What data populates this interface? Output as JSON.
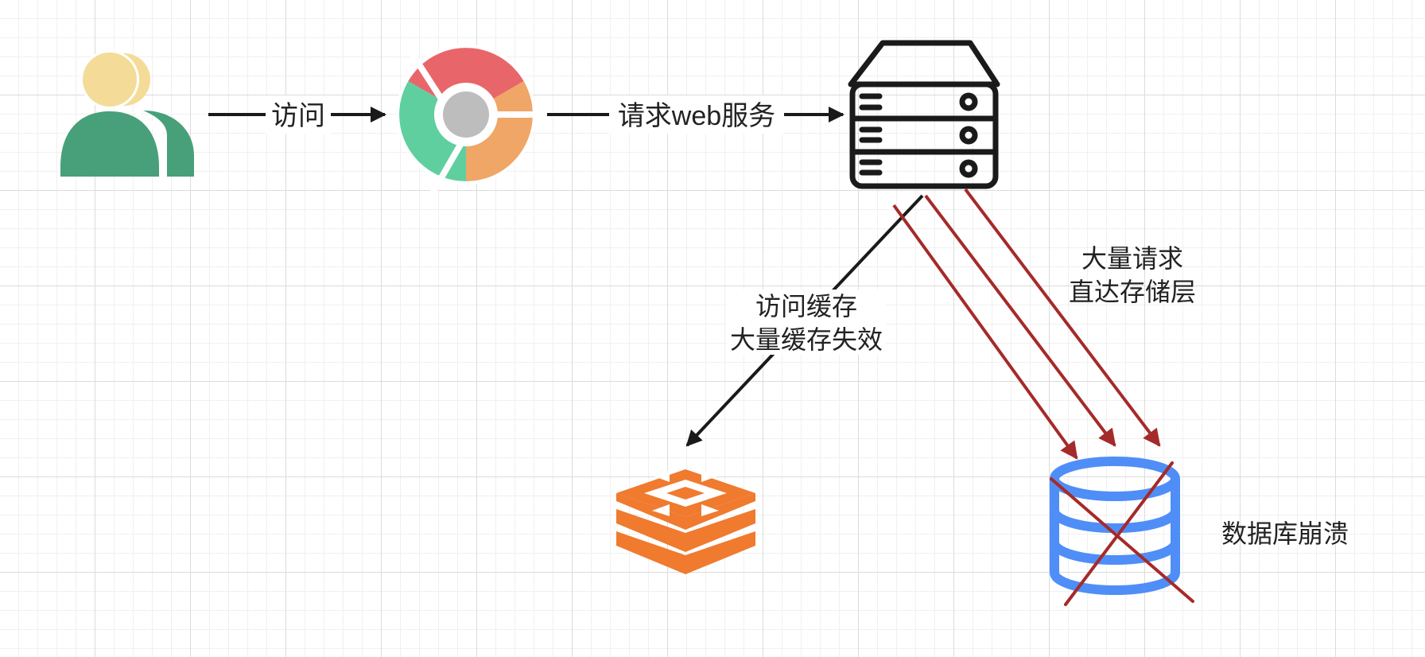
{
  "nodes": {
    "users": {
      "icon": "users-icon",
      "colors": {
        "head": "#F4DC98",
        "body": "#47A079"
      }
    },
    "browser": {
      "icon": "chrome-browser-icon",
      "colors": {
        "red": "#E8666A",
        "green": "#5FCFA0",
        "orange": "#F0A666",
        "center": "#BDBDBD"
      }
    },
    "server": {
      "icon": "server-icon",
      "color": "#1A1A1A"
    },
    "cache": {
      "icon": "redis-cache-icon",
      "color": "#F07A2E"
    },
    "database": {
      "icon": "database-icon",
      "color": "#4F8EF7",
      "label": "数据库崩溃",
      "crossed": true,
      "cross_color": "#A52A2A"
    }
  },
  "edges": {
    "users_to_browser": {
      "label": "访问"
    },
    "browser_to_server": {
      "label": "请求web服务"
    },
    "server_to_cache": {
      "label_line1": "访问缓存",
      "label_line2": "大量缓存失效"
    },
    "server_to_database": {
      "label_line1": "大量请求",
      "label_line2": "直达存储层",
      "arrow_color": "#A52A2A",
      "count": 3
    }
  },
  "colors": {
    "edge": "#1A1A1A",
    "danger": "#A52A2A"
  }
}
